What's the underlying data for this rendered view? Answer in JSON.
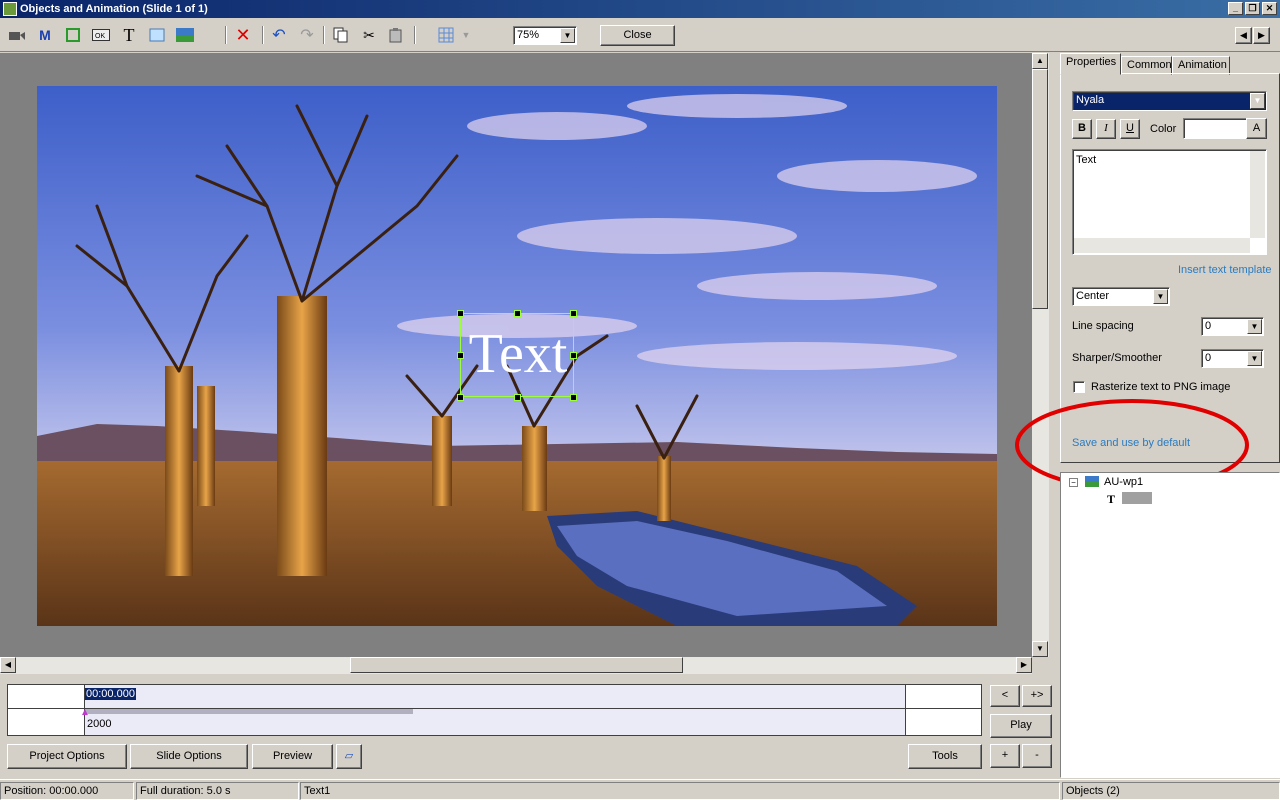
{
  "window": {
    "title": "Objects and Animation  (Slide 1 of 1)"
  },
  "toolbar": {
    "zoom": "75%",
    "close_label": "Close",
    "icons": [
      "camera-icon",
      "m-icon",
      "rectangle-icon",
      "ok-icon",
      "text-icon",
      "frame-icon",
      "image-icon",
      "delete-icon",
      "undo-icon",
      "redo-icon",
      "copy-icon",
      "cut-icon",
      "paste-icon",
      "grid-icon"
    ]
  },
  "canvas": {
    "text_object": "Text"
  },
  "tabs": [
    "Properties",
    "Common",
    "Animation"
  ],
  "properties": {
    "font": "Nyala",
    "bold": "B",
    "italic": "I",
    "underline": "U",
    "color_label": "Color",
    "color_btn": "A",
    "text_value": "Text",
    "insert_template": "Insert text template",
    "align": "Center",
    "line_spacing_label": "Line spacing",
    "line_spacing": "0",
    "sharper_label": "Sharper/Smoother",
    "sharper": "0",
    "rasterize_label": "Rasterize text to PNG image",
    "save_default": "Save and use by default"
  },
  "tree": {
    "root": "AU-wp1",
    "child": "Text1"
  },
  "timeline": {
    "time": "00:00.000",
    "marker": "2000"
  },
  "nav_buttons": {
    "prev": "<",
    "next": "+>",
    "play": "Play",
    "plus": "+",
    "minus": "-"
  },
  "bottom_buttons": {
    "project": "Project Options",
    "slide": "Slide Options",
    "preview": "Preview",
    "tools": "Tools"
  },
  "status": {
    "position": "Position:  00:00.000",
    "duration": "Full duration:  5.0 s",
    "object": "Text1",
    "objects": "Objects (2)"
  },
  "colors": {
    "title_bar": "#0a246a",
    "highlight": "#0a246a",
    "annotation": "#e00000",
    "link": "#2a7bc0"
  }
}
